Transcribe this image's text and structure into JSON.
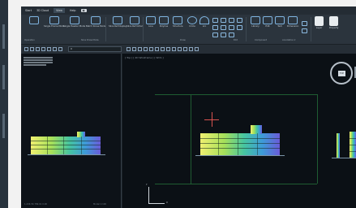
{
  "menu": {
    "items": [
      "Start",
      "3D Cloud",
      "View",
      "Help"
    ],
    "marker": "▣"
  },
  "ribbon": {
    "buttons": [
      {
        "label": "Single Frame Mode",
        "icon": "single-frame-mode-icon"
      },
      {
        "label": "Single Header Mode",
        "icon": "single-header-mode-icon"
      },
      {
        "label": "Batch Slices Mode",
        "icon": "batch-slices-mode-icon"
      },
      {
        "label": "Slice Ref Display",
        "icon": "slice-ref-display-icon"
      },
      {
        "label": "Slice Ref Order",
        "icon": "slice-ref-order-icon"
      },
      {
        "label": "Line",
        "icon": "line-icon"
      },
      {
        "label": "Polyline",
        "icon": "polyline-icon"
      },
      {
        "label": "Structure",
        "icon": "structure-icon"
      },
      {
        "label": "Circle",
        "icon": "circle-icon"
      },
      {
        "label": "Arc",
        "icon": "arc-icon"
      },
      {
        "label": "Library",
        "icon": "library-icon"
      },
      {
        "label": "Edit",
        "icon": "edit-icon"
      },
      {
        "label": "Text",
        "icon": "text-icon"
      },
      {
        "label": "Dimension",
        "icon": "dimension-icon"
      },
      {
        "label": "Layer",
        "icon": "layer-icon"
      },
      {
        "label": "Property",
        "icon": "property-icon"
      }
    ],
    "groups": [
      "Operation",
      "Slice Draw Mode",
      "Draw",
      "Edit",
      "Component",
      "Annotation ▾"
    ]
  },
  "toolbar": {
    "layer_field": "0"
  },
  "viewport": {
    "left_label": "",
    "right_label": "[ Top ] [ 2D Wireframe ] [ WCS ]",
    "cube_face": "TOP",
    "status_left": "1,234.56  789.01  0.00",
    "status_right": "Model  1:100"
  },
  "axis": {
    "x": "X",
    "y": "Y"
  },
  "colors": {
    "app_bg": "#1c2329",
    "viewport_bg": "#0b1015",
    "accent": "#7fb4e0",
    "guide": "#1f5c32"
  }
}
